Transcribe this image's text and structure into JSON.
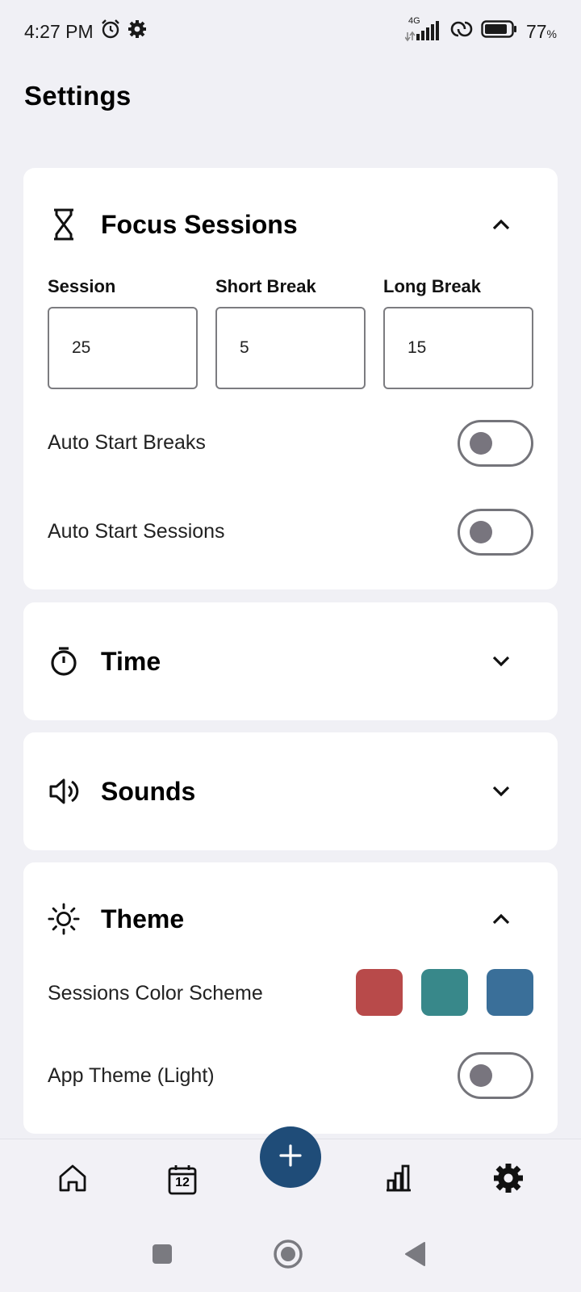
{
  "status_bar": {
    "time": "4:27 PM",
    "network": "4G",
    "battery_percent": "77",
    "battery_unit": "%",
    "icons": [
      "alarm-icon",
      "gear-icon",
      "signal-icon",
      "hotspot-icon",
      "battery-icon"
    ]
  },
  "page": {
    "title": "Settings"
  },
  "focus_sessions": {
    "title": "Focus Sessions",
    "icon": "hourglass-icon",
    "expanded": true,
    "fields": [
      {
        "label": "Session",
        "value": "25"
      },
      {
        "label": "Short Break",
        "value": "5"
      },
      {
        "label": "Long Break",
        "value": "15"
      }
    ],
    "toggles": [
      {
        "label": "Auto Start Breaks",
        "on": false
      },
      {
        "label": "Auto Start Sessions",
        "on": false
      }
    ]
  },
  "time": {
    "title": "Time",
    "icon": "stopwatch-icon",
    "expanded": false
  },
  "sounds": {
    "title": "Sounds",
    "icon": "speaker-icon",
    "expanded": false
  },
  "theme": {
    "title": "Theme",
    "icon": "sun-icon",
    "expanded": true,
    "color_scheme_label": "Sessions Color Scheme",
    "swatches": [
      "#b84a4a",
      "#38888a",
      "#3a6f99"
    ],
    "app_theme_label": "App Theme (Light)",
    "app_theme_on": false
  },
  "bottom_nav": {
    "items": [
      "home-icon",
      "calendar-icon",
      "add-icon",
      "chart-icon",
      "settings-icon"
    ],
    "calendar_day": "12",
    "accent": "#1f4c78"
  }
}
